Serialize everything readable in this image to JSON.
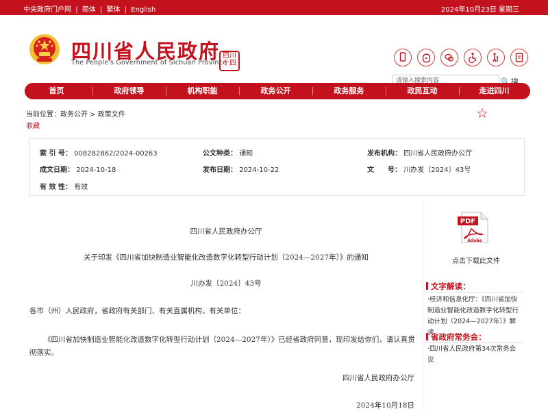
{
  "topbar": {
    "link_central": "中央政府门户网",
    "sep": "|",
    "link_simplified": "简体",
    "link_traditional": "繁体",
    "link_english": "English",
    "date": "2024年10月23日 星期三"
  },
  "header": {
    "title": "四川省人民政府",
    "subtitle": "The People's Government of Sichuan Province",
    "seal_text": "四川\n十四五",
    "search_placeholder": "请输入搜索内容",
    "search_button": "搜 索"
  },
  "nav": [
    "首页",
    "政府领导",
    "机构职能",
    "政务公开",
    "政务服务",
    "政民互动",
    "走进四川"
  ],
  "breadcrumb": {
    "prefix": "当前位置：",
    "item1": "政务公开",
    "arrow": ">",
    "item2": "政策文件"
  },
  "collect": "收藏",
  "meta": {
    "index_label": "索 引 号：",
    "index_value": "008282862/2024-00263",
    "type_label": "公文种类：",
    "type_value": "通知",
    "org_label": "发布机构：",
    "org_value": "四川省人民政府办公厅",
    "created_label": "成文日期：",
    "created_value": "2024-10-18",
    "published_label": "发布日期：",
    "published_value": "2024-10-22",
    "docno_label": "文　　号：",
    "docno_value": "川办发〔2024〕43号",
    "validity_label": "有 效 性：",
    "validity_value": "有效"
  },
  "document": {
    "issuer": "四川省人民政府办公厅",
    "title": "关于印发《四川省加快制造业智能化改造数字化转型行动计划（2024—2027年）》的通知",
    "doc_number": "川办发〔2024〕43号",
    "salutation": "各市（州）人民政府，省政府有关部门、有关直属机构，有关单位：",
    "body": "《四川省加快制造业智能化改造数字化转型行动计划（2024—2027年）》已经省政府同意，现印发给你们，请认真贯彻落实。",
    "signature": "四川省人民政府办公厅",
    "date": "2024年10月18日"
  },
  "sidebar": {
    "pdf_badge": "PDF",
    "pdf_brand": "Adobe",
    "download_label": "点击下载此文件",
    "section1_title": "文字解读：",
    "section1_item": "·经济和信息化厅：《四川省加快制造业智能化改造数字化转型行动计划（2024—2027年）》解读",
    "section2_title": "省政府常务会：",
    "section2_item": "·四川省人民政府第34次常务会议"
  },
  "colors": {
    "brand_red": "#c3121d"
  },
  "icons": [
    "mobile-icon",
    "weibo-icon",
    "wechat-icon",
    "accessibility-icon",
    "elderly-care-icon",
    "tablet-icon"
  ]
}
